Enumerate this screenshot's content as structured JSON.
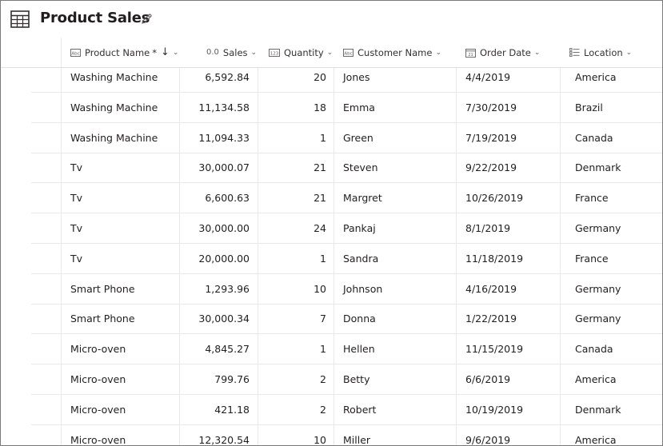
{
  "app": {
    "title": "Product Sales",
    "title_icon": "table-icon",
    "edit_icon": "pencil-icon"
  },
  "columns": [
    {
      "key": "product",
      "label": "Product Name",
      "type_icon": "text-type-icon",
      "required_mark": "*",
      "sort_arrow": "↓",
      "chevron": "chevron-down-icon"
    },
    {
      "key": "sales",
      "label": "Sales",
      "type_icon": "decimal-type-icon",
      "type_text": "0.0",
      "chevron": "chevron-down-icon"
    },
    {
      "key": "quantity",
      "label": "Quantity",
      "type_icon": "number-type-icon",
      "type_text": "123",
      "chevron": "chevron-down-icon"
    },
    {
      "key": "customer",
      "label": "Customer Name",
      "type_icon": "text-type-icon",
      "chevron": "chevron-down-icon"
    },
    {
      "key": "date",
      "label": "Order Date",
      "type_icon": "calendar-type-icon",
      "type_text": "21",
      "chevron": "chevron-down-icon"
    },
    {
      "key": "location",
      "label": "Location",
      "type_icon": "choice-type-icon",
      "chevron": "chevron-down-icon"
    }
  ],
  "rows": [
    {
      "product": "Washing Machine",
      "sales": "6,592.84",
      "quantity": "20",
      "customer": "Jones",
      "date": "4/4/2019",
      "location": "America"
    },
    {
      "product": "Washing Machine",
      "sales": "11,134.58",
      "quantity": "18",
      "customer": "Emma",
      "date": "7/30/2019",
      "location": "Brazil"
    },
    {
      "product": "Washing Machine",
      "sales": "11,094.33",
      "quantity": "1",
      "customer": "Green",
      "date": "7/19/2019",
      "location": "Canada"
    },
    {
      "product": "Tv",
      "sales": "30,000.07",
      "quantity": "21",
      "customer": "Steven",
      "date": "9/22/2019",
      "location": "Denmark"
    },
    {
      "product": "Tv",
      "sales": "6,600.63",
      "quantity": "21",
      "customer": "Margret",
      "date": "10/26/2019",
      "location": "France"
    },
    {
      "product": "Tv",
      "sales": "30,000.00",
      "quantity": "24",
      "customer": "Pankaj",
      "date": "8/1/2019",
      "location": "Germany"
    },
    {
      "product": "Tv",
      "sales": "20,000.00",
      "quantity": "1",
      "customer": "Sandra",
      "date": "11/18/2019",
      "location": "France"
    },
    {
      "product": "Smart Phone",
      "sales": "1,293.96",
      "quantity": "10",
      "customer": "Johnson",
      "date": "4/16/2019",
      "location": "Germany"
    },
    {
      "product": "Smart Phone",
      "sales": "30,000.34",
      "quantity": "7",
      "customer": "Donna",
      "date": "1/22/2019",
      "location": "Germany"
    },
    {
      "product": "Micro-oven",
      "sales": "4,845.27",
      "quantity": "1",
      "customer": "Hellen",
      "date": "11/15/2019",
      "location": "Canada"
    },
    {
      "product": "Micro-oven",
      "sales": "799.76",
      "quantity": "2",
      "customer": "Betty",
      "date": "6/6/2019",
      "location": "America"
    },
    {
      "product": "Micro-oven",
      "sales": "421.18",
      "quantity": "2",
      "customer": "Robert",
      "date": "10/19/2019",
      "location": "Denmark"
    },
    {
      "product": "Micro-oven",
      "sales": "12,320.54",
      "quantity": "10",
      "customer": "Miller",
      "date": "9/6/2019",
      "location": "America"
    }
  ],
  "colors": {
    "border": "#7a7a7a",
    "gridline": "#ebe9e7",
    "text": "#201f1e"
  }
}
